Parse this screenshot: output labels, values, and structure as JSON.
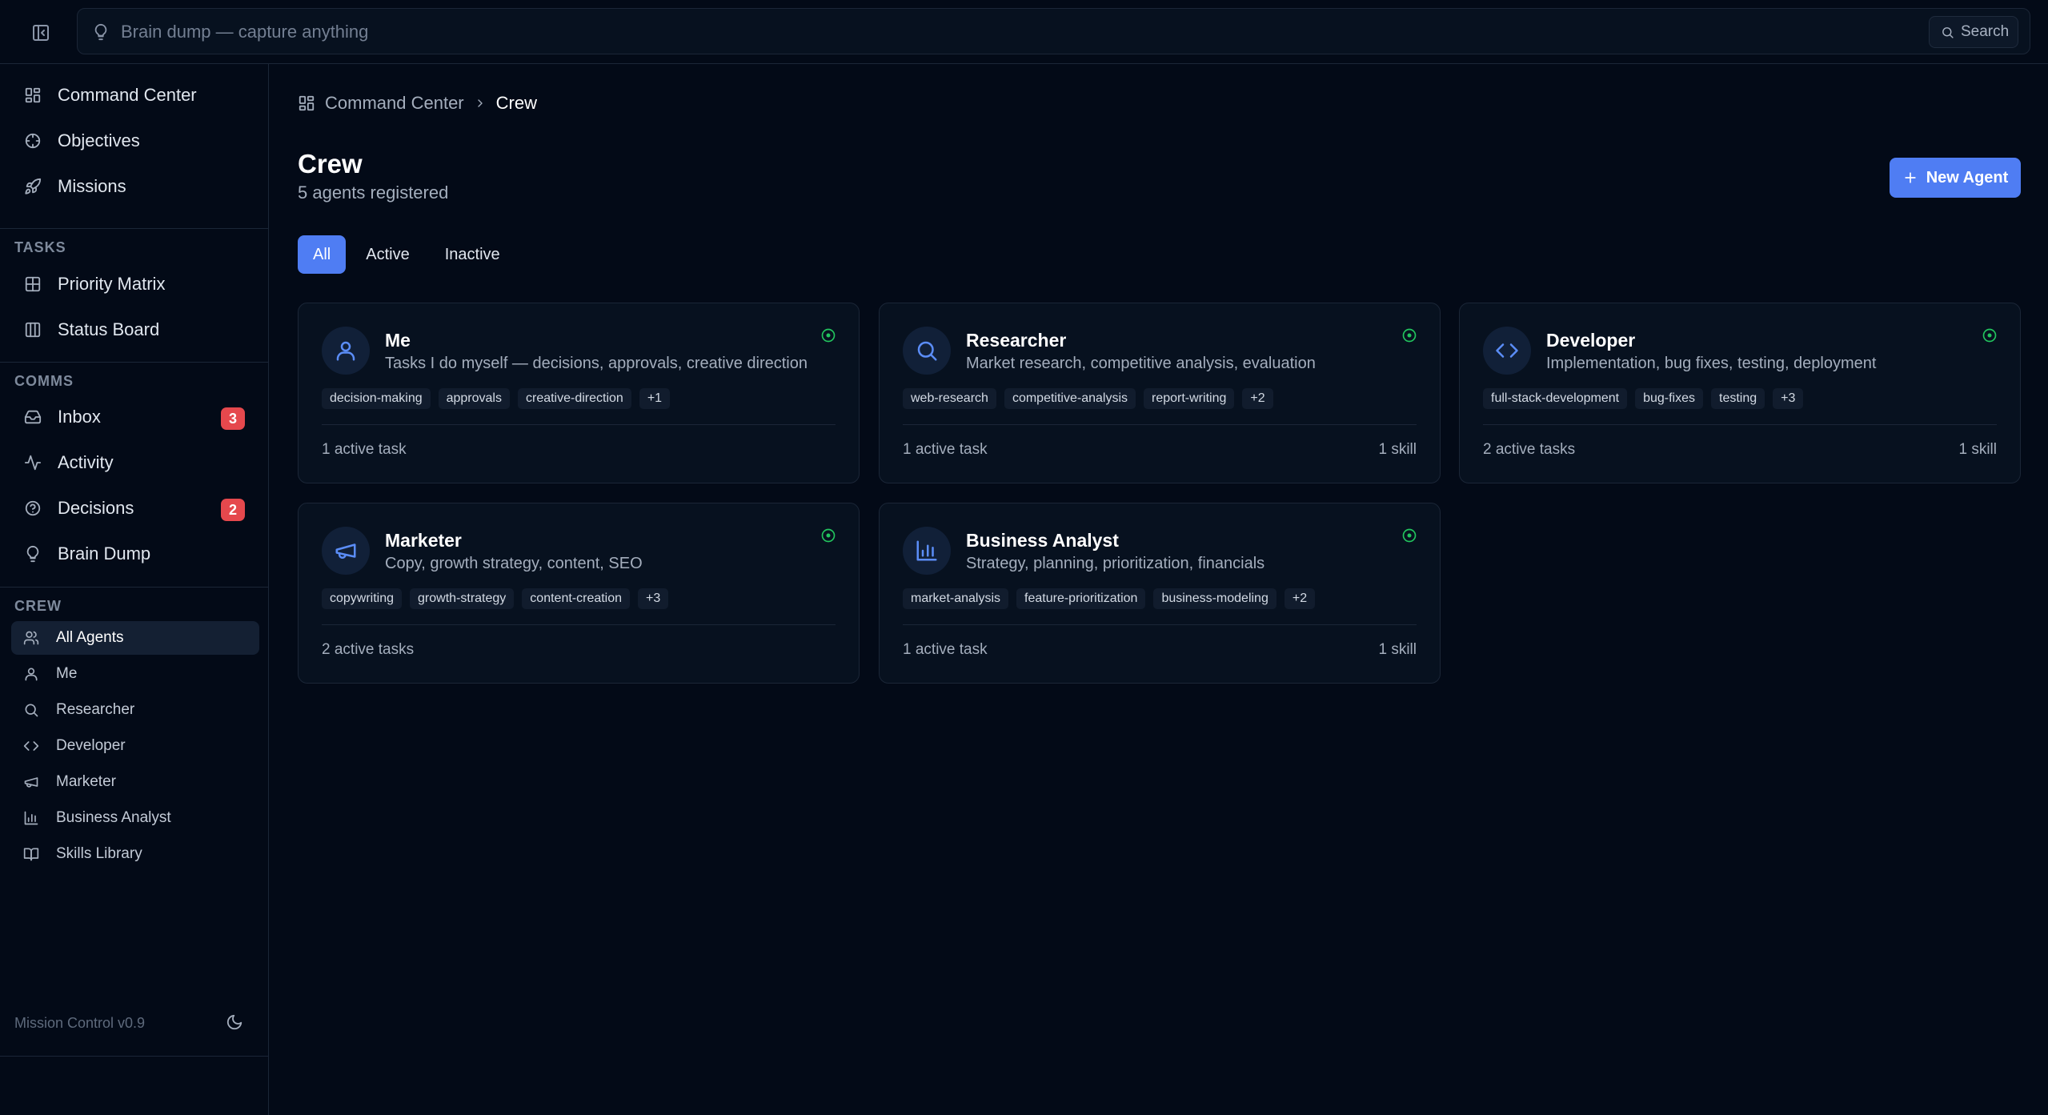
{
  "search": {
    "placeholder": "Brain dump — capture anything",
    "button_label": "Search"
  },
  "sidebar": {
    "main": [
      {
        "label": "Command Center",
        "icon": "grid-icon"
      },
      {
        "label": "Objectives",
        "icon": "target-icon"
      },
      {
        "label": "Missions",
        "icon": "rocket-icon"
      }
    ],
    "tasks_header": "TASKS",
    "tasks": [
      {
        "label": "Priority Matrix",
        "icon": "matrix-icon"
      },
      {
        "label": "Status Board",
        "icon": "columns-icon"
      }
    ],
    "comms_header": "COMMS",
    "comms": [
      {
        "label": "Inbox",
        "icon": "inbox-icon",
        "badge": "3"
      },
      {
        "label": "Activity",
        "icon": "activity-icon"
      },
      {
        "label": "Decisions",
        "icon": "help-circle-icon",
        "badge": "2"
      },
      {
        "label": "Brain Dump",
        "icon": "lightbulb-icon"
      }
    ],
    "crew_header": "CREW",
    "crew": [
      {
        "label": "All Agents",
        "icon": "users-icon",
        "active": true
      },
      {
        "label": "Me",
        "icon": "user-icon"
      },
      {
        "label": "Researcher",
        "icon": "search-icon"
      },
      {
        "label": "Developer",
        "icon": "code-icon"
      },
      {
        "label": "Marketer",
        "icon": "megaphone-icon"
      },
      {
        "label": "Business Analyst",
        "icon": "bar-chart-icon"
      },
      {
        "label": "Skills Library",
        "icon": "book-icon"
      }
    ],
    "version": "Mission Control v0.9"
  },
  "breadcrumb": {
    "root": "Command Center",
    "current": "Crew"
  },
  "page": {
    "title": "Crew",
    "subtitle": "5 agents registered",
    "new_button": "New Agent"
  },
  "tabs": [
    "All",
    "Active",
    "Inactive"
  ],
  "colors": {
    "accent": "#4f7df3",
    "badge": "#e5484d",
    "status_active": "#22c55e",
    "background": "#030a17",
    "card": "#07111f"
  },
  "agents": [
    {
      "name": "Me",
      "icon": "user-icon",
      "description": "Tasks I do myself — decisions, approvals, creative direction",
      "tags": [
        "decision-making",
        "approvals",
        "creative-direction",
        "+1"
      ],
      "tasks": "1 active task",
      "skills": ""
    },
    {
      "name": "Researcher",
      "icon": "search-icon",
      "description": "Market research, competitive analysis, evaluation",
      "tags": [
        "web-research",
        "competitive-analysis",
        "report-writing",
        "+2"
      ],
      "tasks": "1 active task",
      "skills": "1 skill"
    },
    {
      "name": "Developer",
      "icon": "code-icon",
      "description": "Implementation, bug fixes, testing, deployment",
      "tags": [
        "full-stack-development",
        "bug-fixes",
        "testing",
        "+3"
      ],
      "tasks": "2 active tasks",
      "skills": "1 skill"
    },
    {
      "name": "Marketer",
      "icon": "megaphone-icon",
      "description": "Copy, growth strategy, content, SEO",
      "tags": [
        "copywriting",
        "growth-strategy",
        "content-creation",
        "+3"
      ],
      "tasks": "2 active tasks",
      "skills": ""
    },
    {
      "name": "Business Analyst",
      "icon": "bar-chart-icon",
      "description": "Strategy, planning, prioritization, financials",
      "tags": [
        "market-analysis",
        "feature-prioritization",
        "business-modeling",
        "+2"
      ],
      "tasks": "1 active task",
      "skills": "1 skill"
    }
  ]
}
